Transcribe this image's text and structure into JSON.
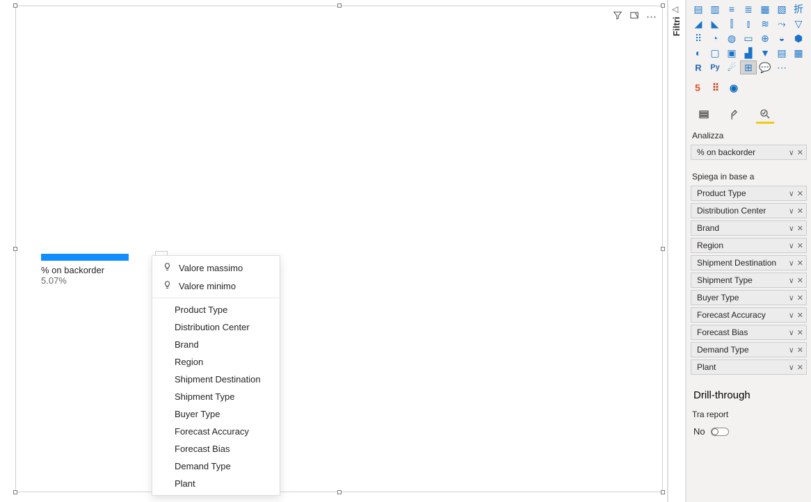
{
  "filter_panel_label": "Filtri",
  "header_icons": {
    "filter": "filter",
    "focus": "focus",
    "more": "more"
  },
  "metric": {
    "label": "% on backorder",
    "value": "5.07%"
  },
  "context_menu": {
    "top": [
      {
        "icon": "bulb",
        "label": "Valore massimo"
      },
      {
        "icon": "bulb",
        "label": "Valore minimo"
      }
    ],
    "fields": [
      "Product Type",
      "Distribution Center",
      "Brand",
      "Region",
      "Shipment Destination",
      "Shipment Type",
      "Buyer Type",
      "Forecast Accuracy",
      "Forecast Bias",
      "Demand Type",
      "Plant"
    ]
  },
  "viz_icons": [
    "stacked-bar",
    "stacked-column",
    "clustered-bar",
    "clustered-column",
    "100-bar",
    "100-column",
    "line",
    "area",
    "stacked-area",
    "line-column",
    "line-column-clustered",
    "ribbon",
    "waterfall",
    "funnel",
    "scatter",
    "pie",
    "donut",
    "treemap",
    "map",
    "filled-map",
    "shape-map",
    "gauge",
    "card",
    "multi-card",
    "kpi",
    "slicer",
    "table",
    "matrix",
    "r",
    "python",
    "key-influencer",
    "decomposition",
    "qa",
    "more"
  ],
  "custom_visuals": [
    {
      "name": "html5-custom-visual",
      "glyph": "5",
      "color": "#E34F26"
    },
    {
      "name": "grid-custom-visual",
      "glyph": "⠿",
      "color": "#C43E1C"
    },
    {
      "name": "play-custom-visual",
      "glyph": "◉",
      "color": "#0F6CBD"
    }
  ],
  "tool_tabs": {
    "fields": "Campi",
    "format": "Formato",
    "analytics": "Analizza"
  },
  "sections": {
    "analyze_label": "Analizza",
    "analyze_field_group": [
      "% on backorder"
    ],
    "explain_label": "Spiega in base a",
    "explain_fields": [
      "Product Type",
      "Distribution Center",
      "Brand",
      "Region",
      "Shipment Destination",
      "Shipment Type",
      "Buyer Type",
      "Forecast Accuracy",
      "Forecast Bias",
      "Demand Type",
      "Plant"
    ]
  },
  "drillthrough": {
    "title": "Drill-through",
    "cross_report_label": "Tra report",
    "cross_report_value": "No"
  }
}
